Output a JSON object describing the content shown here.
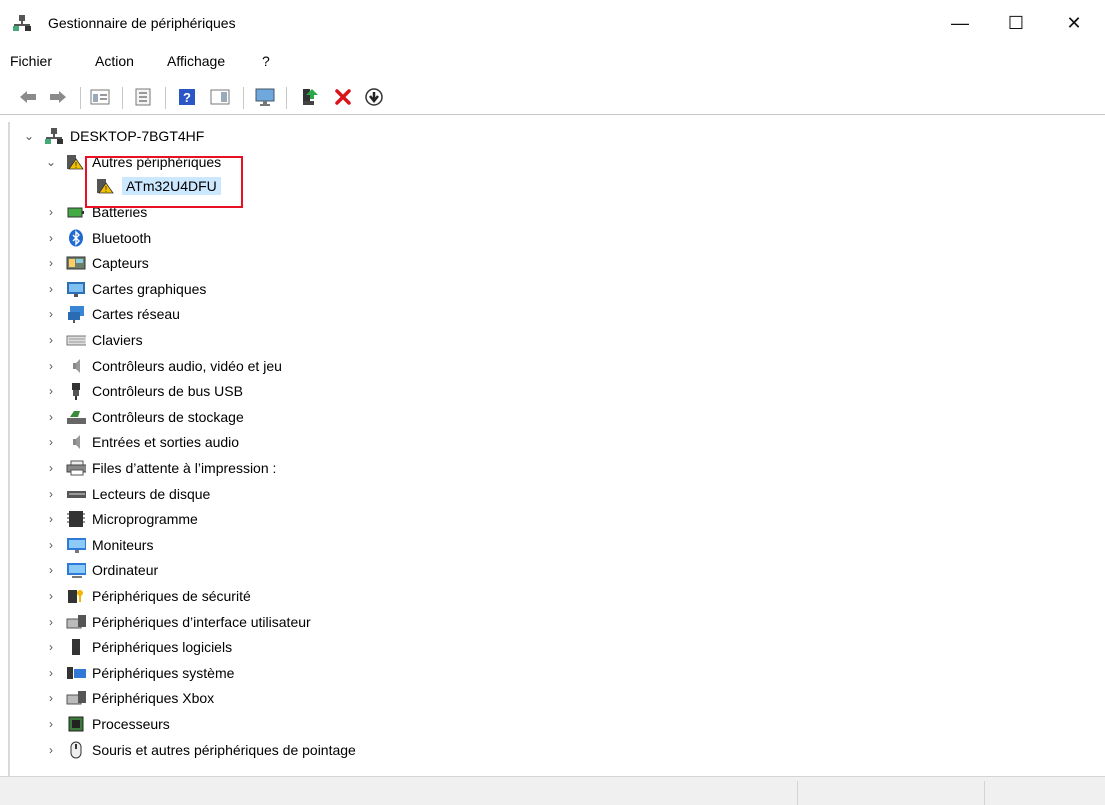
{
  "window": {
    "title": "Gestionnaire de périphériques",
    "minimize": "—",
    "maximize": "☐",
    "close": "✕"
  },
  "menu": [
    "Fichier",
    "Action",
    "Affichage",
    "?"
  ],
  "toolbar": [
    "back",
    "forward",
    "properties",
    "update-driver",
    "help",
    "show-view",
    "scan-hardware",
    "enable-device",
    "uninstall",
    "download"
  ],
  "tree": {
    "root": "DESKTOP-7BGT4HF",
    "other_devices": {
      "label": "Autres périphériques",
      "children": [
        "ATm32U4DFU"
      ]
    },
    "categories": [
      "Batteries",
      "Bluetooth",
      "Capteurs",
      "Cartes graphiques",
      "Cartes réseau",
      "Claviers",
      "Contrôleurs audio, vidéo et jeu",
      "Contrôleurs de bus USB",
      "Contrôleurs de stockage",
      "Entrées et sorties audio",
      "Files d’attente à l’impression :",
      "Lecteurs de disque",
      "Microprogramme",
      "Moniteurs",
      "Ordinateur",
      "Périphériques de sécurité",
      "Périphériques d’interface utilisateur",
      "Périphériques logiciels",
      "Périphériques système",
      "Périphériques Xbox",
      "Processeurs",
      "Souris et autres périphériques de pointage"
    ]
  }
}
